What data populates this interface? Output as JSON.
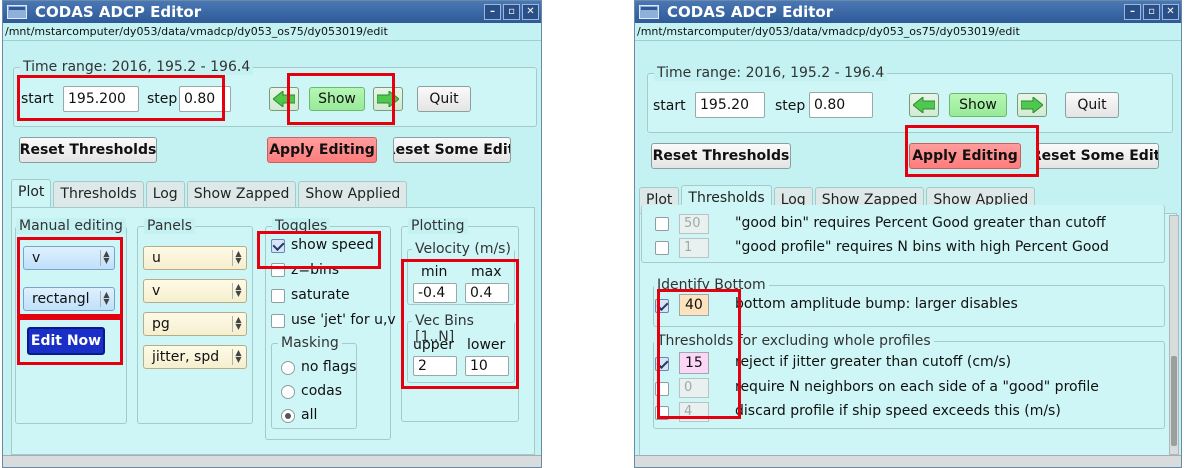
{
  "left": {
    "title": "CODAS ADCP Editor",
    "path": "/mnt/mstarcomputer/dy053/data/vmadcp/dy053_os75/dy053019/edit",
    "time_range": "Time range:  2016, 195.2 - 196.4",
    "start_label": "start",
    "start_value": "195.200",
    "step_label": "step",
    "step_value": "0.80",
    "show_label": "Show",
    "quit_label": "Quit",
    "reset_thresholds": "Reset Thresholds",
    "apply_editing": "Apply Editing",
    "reset_some": "Reset Some Editi",
    "tabs": [
      "Plot",
      "Thresholds",
      "Log",
      "Show Zapped",
      "Show Applied"
    ],
    "manual_editing": {
      "title": "Manual editing",
      "select1": "v",
      "select2": "rectangl",
      "edit_now": "Edit Now"
    },
    "panels": {
      "title": "Panels",
      "items": [
        "u",
        "v",
        "pg",
        "jitter, spd"
      ]
    },
    "toggles": {
      "title": "Toggles",
      "items": [
        "show speed",
        "z=bins",
        "saturate",
        "use 'jet' for u,v"
      ]
    },
    "masking": {
      "title": "Masking",
      "items": [
        "no flags",
        "codas",
        "all"
      ]
    },
    "plotting": {
      "title": "Plotting",
      "velocity_title": "Velocity (m/s)",
      "min_label": "min",
      "max_label": "max",
      "min_value": "-0.4",
      "max_value": "0.4",
      "vecbins_title": "Vec Bins [1..N]",
      "upper_label": "upper",
      "lower_label": "lower",
      "upper_value": "2",
      "lower_value": "10"
    }
  },
  "right": {
    "title": "CODAS ADCP Editor",
    "path": "/mnt/mstarcomputer/dy053/data/vmadcp/dy053_os75/dy053019/edit",
    "time_range": "Time range:  2016, 195.2 - 196.4",
    "start_label": "start",
    "start_value": "195.20",
    "step_label": "step",
    "step_value": "0.80",
    "show_label": "Show",
    "quit_label": "Quit",
    "reset_thresholds": "Reset Thresholds",
    "apply_editing": "Apply Editing",
    "reset_some": "Reset Some Editi",
    "tabs": [
      "Plot",
      "Thresholds",
      "Log",
      "Show Zapped",
      "Show Applied"
    ],
    "rows_top": [
      {
        "value": "50",
        "label": "\"good bin\" requires  Percent Good greater than cutoff"
      },
      {
        "value": "1",
        "label": "\"good profile\" requires N bins with high Percent Good"
      }
    ],
    "identify_bottom": {
      "title": "Identify Bottom",
      "value": "40",
      "label": "bottom amplitude bump: larger disables"
    },
    "whole_profiles": {
      "title": "Thresholds for excluding whole profiles",
      "rows": [
        {
          "value": "15",
          "label": "reject if jitter greater than cutoff (cm/s)"
        },
        {
          "value": "0",
          "label": "require N neighbors on each side of a \"good\" profile"
        },
        {
          "value": "4",
          "label": "discard profile if ship speed exceeds this (m/s)"
        }
      ]
    }
  },
  "colors": {
    "highlight": "#e5000f",
    "window_bg": "#c4f2f2",
    "titlebar": "#3a68a8",
    "apply_button": "#ff8a8a",
    "show_button": "#a6f0a6"
  }
}
